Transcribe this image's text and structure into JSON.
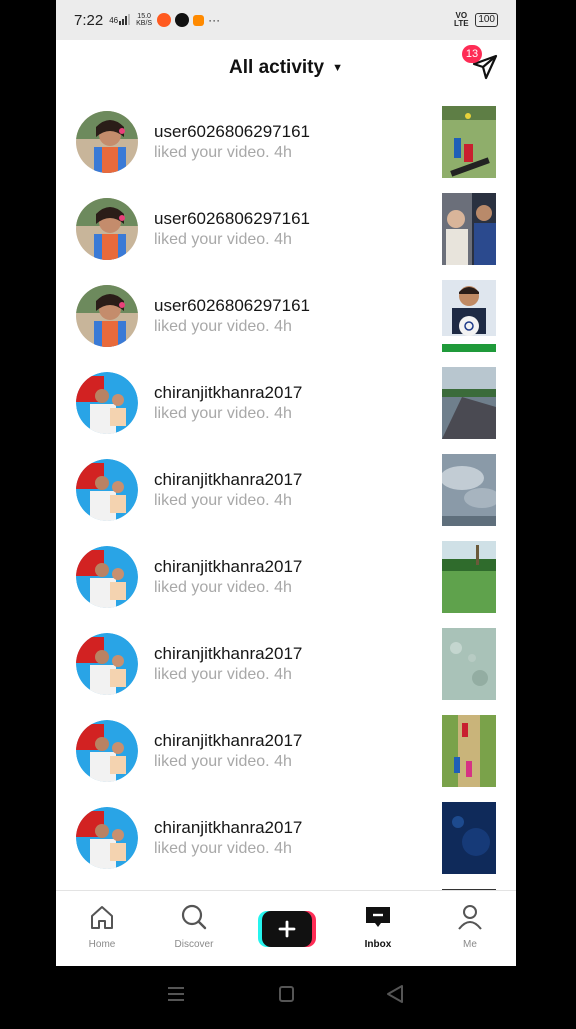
{
  "status_bar": {
    "time": "7:22",
    "signal": "46",
    "speed": "15.0 KB/S",
    "volte": "VO LTE",
    "battery": "100"
  },
  "header": {
    "title": "All activity",
    "dropdown_icon": "caret-down-icon",
    "notification_count": "13",
    "send_icon": "paper-plane-icon"
  },
  "activity": {
    "items": [
      {
        "username": "user6026806297161",
        "action": "liked your video.",
        "time": "4h"
      },
      {
        "username": "user6026806297161",
        "action": "liked your video.",
        "time": "4h"
      },
      {
        "username": "user6026806297161",
        "action": "liked your video.",
        "time": "4h"
      },
      {
        "username": "chiranjitkhanra2017",
        "action": "liked your video.",
        "time": "4h"
      },
      {
        "username": "chiranjitkhanra2017",
        "action": "liked your video.",
        "time": "4h"
      },
      {
        "username": "chiranjitkhanra2017",
        "action": "liked your video.",
        "time": "4h"
      },
      {
        "username": "chiranjitkhanra2017",
        "action": "liked your video.",
        "time": "4h"
      },
      {
        "username": "chiranjitkhanra2017",
        "action": "liked your video.",
        "time": "4h"
      },
      {
        "username": "chiranjitkhanra2017",
        "action": "liked your video.",
        "time": "4h"
      }
    ]
  },
  "tabs": [
    {
      "label": "Home",
      "icon": "home-icon"
    },
    {
      "label": "Discover",
      "icon": "search-icon"
    },
    {
      "label": "",
      "icon": "plus-icon"
    },
    {
      "label": "Inbox",
      "icon": "inbox-icon"
    },
    {
      "label": "Me",
      "icon": "profile-icon"
    }
  ],
  "colors": {
    "accent": "#fe2c55",
    "cyan": "#25f4ee",
    "muted_text": "#a8a8a8"
  }
}
